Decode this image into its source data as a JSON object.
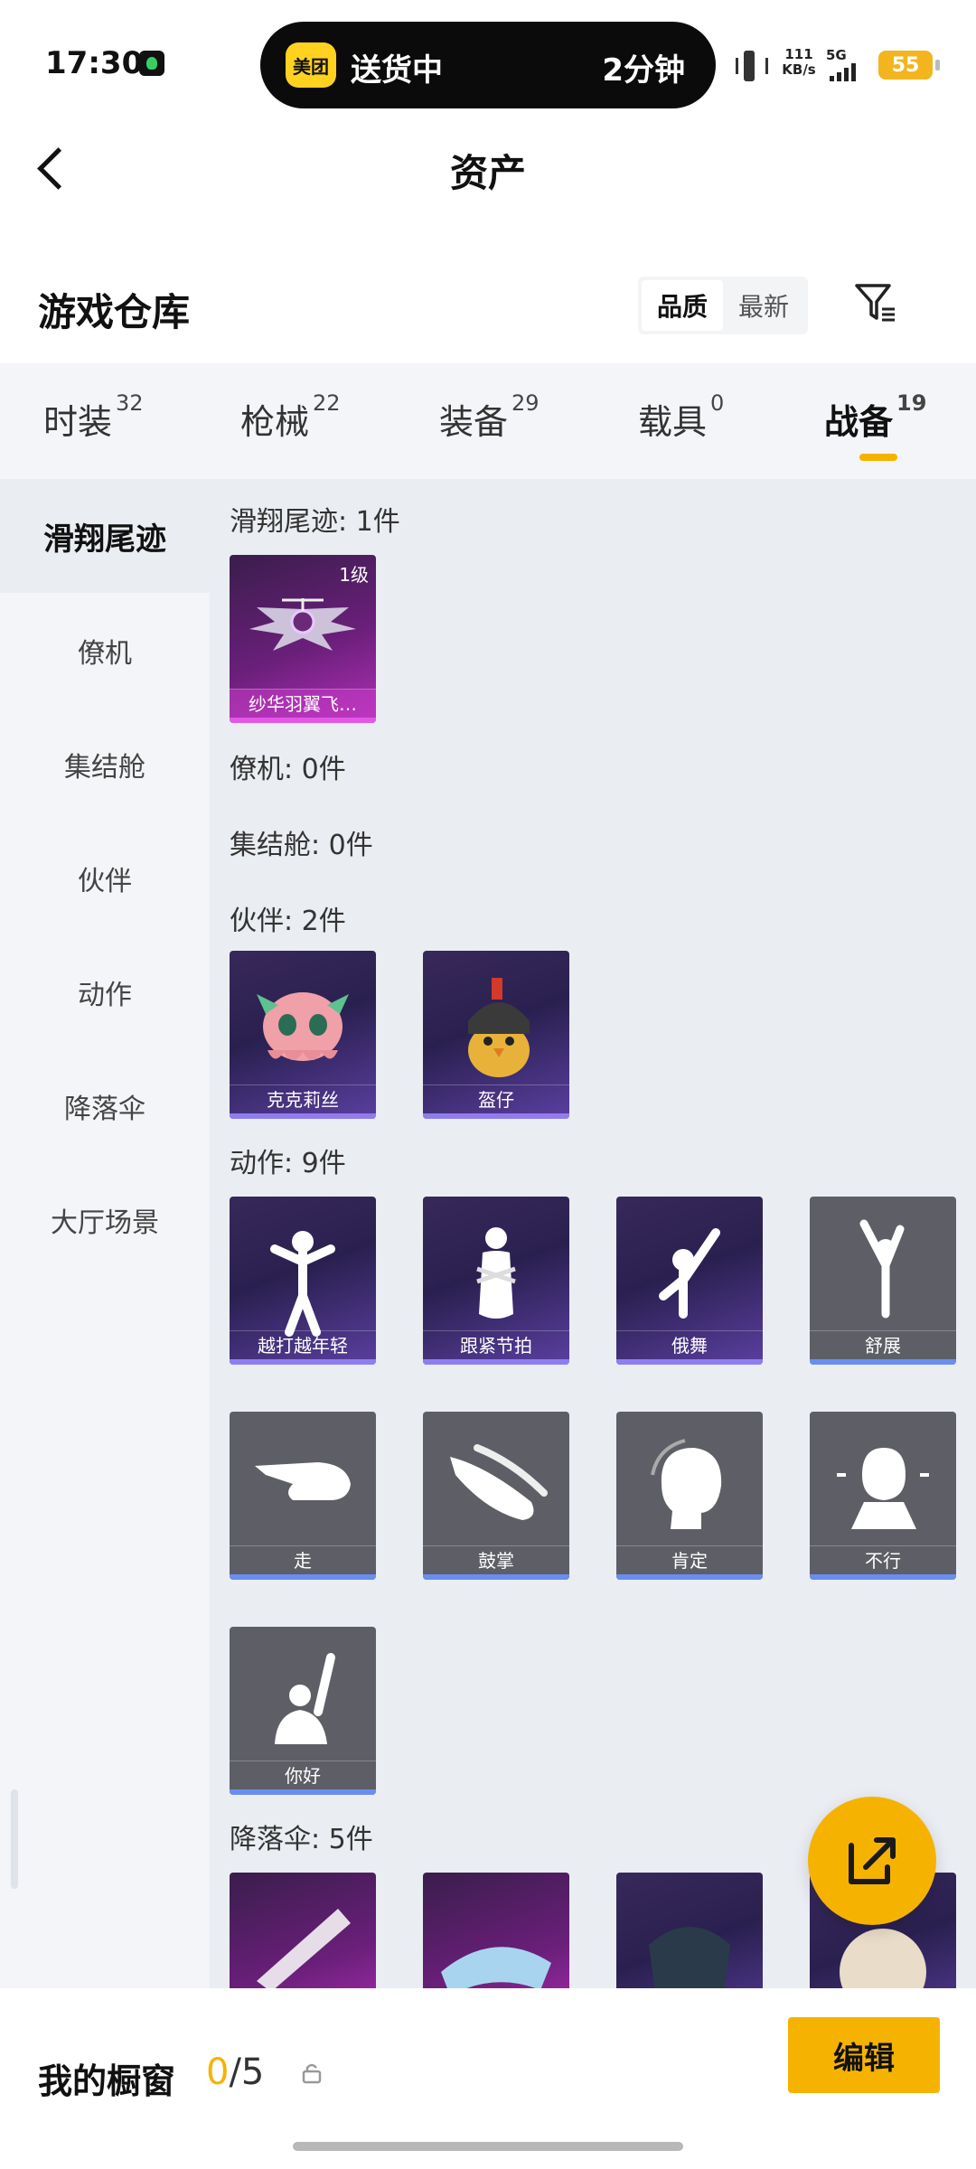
{
  "status_bar": {
    "time": "17:30",
    "island_brand": "美团",
    "island_status": "送货中",
    "island_eta": "2分钟",
    "net_speed_value": "111",
    "net_speed_unit": "KB/s",
    "network_type": "5G",
    "battery": "55",
    "colors": {
      "island": "#0b0b0b",
      "battery": "#f3b51d"
    }
  },
  "header": {
    "title": "资产"
  },
  "warehouse": {
    "title": "游戏仓库",
    "sort_options": [
      "品质",
      "最新"
    ],
    "sort_active": "品质"
  },
  "tabs": [
    {
      "label": "时装",
      "count": "32"
    },
    {
      "label": "枪械",
      "count": "22"
    },
    {
      "label": "装备",
      "count": "29"
    },
    {
      "label": "载具",
      "count": "0"
    },
    {
      "label": "战备",
      "count": "19",
      "active": true
    }
  ],
  "sidebar": {
    "items": [
      "滑翔尾迹",
      "僚机",
      "集结舱",
      "伙伴",
      "动作",
      "降落伞",
      "大厅场景"
    ],
    "active": "滑翔尾迹"
  },
  "groups": {
    "glide_trail": {
      "label": "滑翔尾迹: 1件",
      "items": [
        {
          "name": "纱华羽翼飞…",
          "level": "1级"
        }
      ]
    },
    "wingman": {
      "label": "僚机: 0件"
    },
    "rally_pod": {
      "label": "集结舱: 0件"
    },
    "companion": {
      "label": "伙伴: 2件",
      "items": [
        {
          "name": "克克莉丝"
        },
        {
          "name": "盔仔"
        }
      ]
    },
    "emote": {
      "label": "动作: 9件",
      "items": [
        {
          "name": "越打越年轻"
        },
        {
          "name": "跟紧节拍"
        },
        {
          "name": "俄舞"
        },
        {
          "name": "舒展"
        },
        {
          "name": "走"
        },
        {
          "name": "鼓掌"
        },
        {
          "name": "肯定"
        },
        {
          "name": "不行"
        },
        {
          "name": "你好"
        }
      ]
    },
    "parachute": {
      "label": "降落伞: 5件"
    }
  },
  "bottom_bar": {
    "showcase_label": "我的橱窗",
    "showcase_current": "0",
    "showcase_total": "/5",
    "edit_label": "编辑"
  },
  "colors": {
    "accent": "#f5b300",
    "content_bg": "#eaedf2",
    "sidebar_bg": "#f3f5f8"
  }
}
